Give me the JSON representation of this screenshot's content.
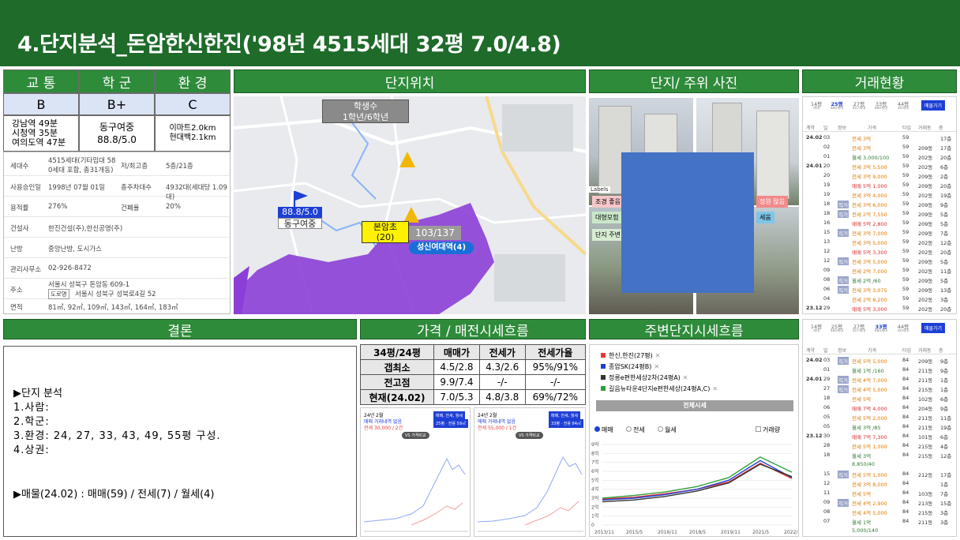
{
  "title": "4.단지분석_돈암한신한진('98년 4515세대 32평 7.0/4.8)",
  "colors": {
    "header_green": "#2e8b3a",
    "title_bar": "#1e6b2a",
    "grade_bg": "#dbe4f5",
    "school_zone": "#8b3fd6"
  },
  "score": {
    "headers": [
      "교 통",
      "학 군",
      "환 경"
    ],
    "grades": [
      "B",
      "B+",
      "C"
    ],
    "transport_lines": [
      "강남역 49분",
      "시청역 35분",
      "여의도역 47분"
    ],
    "school_lines": [
      "동구여중",
      "88.8/5.0"
    ],
    "env_lines": [
      "이마트2.0km",
      "현대백2.1km"
    ]
  },
  "info": [
    {
      "k": "세대수",
      "v": "4515세대(기타임대 58",
      "v2": "0세대 포함, 총31개동)",
      "k2": "저/최고층",
      "v3": "5층/21층"
    },
    {
      "k": "사용승인일",
      "v": "1998년 07월 01일",
      "k2": "총주차대수",
      "v3": "4932대(세대당 1.09대)"
    },
    {
      "k": "용적률",
      "v": "276%",
      "k2": "건폐율",
      "v3": "20%"
    },
    {
      "k": "건설사",
      "v": "한진건설(주),한신공영(주)"
    },
    {
      "k": "난방",
      "v": "중앙난방, 도시가스"
    },
    {
      "k": "관리사무소",
      "v": "02-926-8472"
    },
    {
      "k": "주소",
      "v": "서울시 성북구 돈암동 609-1",
      "tag": "도로명",
      "v2": "서울시 성북구 성북로4길 52"
    },
    {
      "k": "면적",
      "v": "81㎡, 92㎡, 109㎡, 143㎡, 164㎡, 183㎡"
    }
  ],
  "sections": {
    "location": "단지위치",
    "photos": "단지/ 주위 사진",
    "transactions": "거래현황",
    "conclusion": "결론",
    "price_trend": "가격 / 매전시세흐름",
    "nearby_trend": "주변단지시세흐름"
  },
  "map": {
    "students_line1": "학생수",
    "students_line2": "1학년/6학년",
    "school_score": "88.8/5.0",
    "school_name": "동구여중",
    "elem_line1": "본암초",
    "elem_line2": "(20)",
    "ratio": "103/137",
    "station": "성신여대역(4)"
  },
  "photo_overlay": {
    "tags": [
      "Labels",
      "조경 좋음",
      "대형모험",
      "단지 주변",
      "정원 많음",
      "세움"
    ]
  },
  "transactions": {
    "top_tabs": [
      "14평",
      "25평",
      "27평",
      "33평",
      "44평"
    ],
    "top_tab_sub": [
      "세대",
      "480세대",
      "507세대",
      "480세대",
      "46세대"
    ],
    "active_tab_top": "25평",
    "active_tab_bottom": "33평",
    "btn": "매물가기",
    "col_headers": [
      "계약",
      "일",
      "정보",
      "가격",
      "타입",
      "거래동",
      "층"
    ],
    "top_rows": [
      [
        "24.02",
        "03",
        "",
        "전세 3억",
        "59",
        "",
        "17층"
      ],
      [
        "",
        "02",
        "",
        "전세 3억",
        "59",
        "209동",
        "17층"
      ],
      [
        "",
        "01",
        "",
        "월세 3,000/100",
        "59",
        "202동",
        "20층"
      ],
      [
        "24.01",
        "20",
        "",
        "전세 3억 5,500",
        "59",
        "202동",
        "6층"
      ],
      [
        "",
        "20",
        "",
        "전세 3억 9,000",
        "59",
        "209동",
        "2층"
      ],
      [
        "",
        "19",
        "",
        "매매 5억 1,000",
        "59",
        "209동",
        "20층"
      ],
      [
        "",
        "19",
        "",
        "전세 3억 4,000",
        "59",
        "202동",
        "19층"
      ],
      [
        "",
        "18",
        "직거",
        "전세 3억 6,000",
        "59",
        "209동",
        "9층"
      ],
      [
        "",
        "18",
        "직거",
        "전세 2억 7,550",
        "59",
        "209동",
        "5층"
      ],
      [
        "",
        "16",
        "",
        "매매 5억 2,800",
        "59",
        "209동",
        "5층"
      ],
      [
        "",
        "15",
        "직거",
        "전세 3억 7,000",
        "59",
        "209동",
        "7층"
      ],
      [
        "",
        "13",
        "",
        "전세 3억 5,000",
        "59",
        "202동",
        "12층"
      ],
      [
        "",
        "12",
        "",
        "매매 5억 3,300",
        "59",
        "202동",
        "20층"
      ],
      [
        "",
        "12",
        "직거",
        "전세 3억 5,000",
        "59",
        "209동",
        "5층"
      ],
      [
        "",
        "09",
        "",
        "전세 2억 7,000",
        "59",
        "202동",
        "11층"
      ],
      [
        "",
        "08",
        "직거",
        "월세 2억 /60",
        "59",
        "209동",
        "5층"
      ],
      [
        "",
        "06",
        "직거",
        "전세 3억 3,075",
        "59",
        "209동",
        "13층"
      ],
      [
        "",
        "04",
        "",
        "전세 2억 8,200",
        "59",
        "202동",
        "3층"
      ],
      [
        "23.12",
        "29",
        "",
        "매매 5억 3,000",
        "59",
        "202동",
        "20층"
      ]
    ],
    "bottom_rows": [
      [
        "24.02",
        "03",
        "직거",
        "전세 5억 5,000",
        "84",
        "209동",
        "9층"
      ],
      [
        "",
        "01",
        "",
        "월세 1억 /160",
        "84",
        "211동",
        "9층"
      ],
      [
        "24.01",
        "29",
        "직거",
        "전세 4억 7,000",
        "84",
        "211동",
        "1층"
      ],
      [
        "",
        "27",
        "직거",
        "전세 4억 5,000",
        "84",
        "215동",
        "1층"
      ],
      [
        "",
        "18",
        "",
        "전세 5억",
        "84",
        "102동",
        "6층"
      ],
      [
        "",
        "06",
        "",
        "매매 7억 4,000",
        "84",
        "204동",
        "9층"
      ],
      [
        "",
        "05",
        "",
        "전세 5억 2,000",
        "84",
        "211동",
        "11층"
      ],
      [
        "",
        "05",
        "",
        "월세 3억 /85",
        "84",
        "211동",
        "19층"
      ],
      [
        "23.12",
        "30",
        "",
        "매매 7억 7,300",
        "84",
        "101동",
        "6층"
      ],
      [
        "",
        "28",
        "",
        "전세 5억 1,000",
        "84",
        "215동",
        "4층"
      ],
      [
        "",
        "18",
        "",
        "월세 3억",
        "84",
        "215동",
        "12층"
      ],
      [
        "",
        "",
        "",
        "8,850/40",
        "",
        "",
        ""
      ],
      [
        "",
        "15",
        "직거",
        "전세 5억 1,000",
        "84",
        "212동",
        "17층"
      ],
      [
        "",
        "12",
        "",
        "전세 3억 8,000",
        "84",
        "",
        "1층"
      ],
      [
        "",
        "11",
        "",
        "전세 5억",
        "84",
        "103동",
        "7층"
      ],
      [
        "",
        "09",
        "직거",
        "전세 4억 2,900",
        "84",
        "213동",
        "15층"
      ],
      [
        "",
        "08",
        "",
        "전세 4억 5,000",
        "84",
        "215동",
        "3층"
      ],
      [
        "",
        "07",
        "",
        "월세 1억",
        "84",
        "211동",
        "3층"
      ],
      [
        "",
        "",
        "",
        "5,000/140",
        "",
        "",
        ""
      ],
      [
        "",
        "04",
        "",
        "전세 4억 5,000",
        "84",
        "215동",
        "3층"
      ]
    ]
  },
  "conclusion": {
    "heading": "▶단지 분석",
    "lines": [
      "1.사람:",
      "2.학군:",
      "3.환경: 24, 27, 33, 43, 49, 55평 구성.",
      "4.상권:"
    ],
    "listing": "▶매물(24.02) : 매매(59) / 전세(7) / 월세(4)"
  },
  "price_table": {
    "header": [
      "34평/24평",
      "매매가",
      "전세가",
      "전세가율"
    ],
    "rows": [
      [
        "갭최소",
        "4.5/2.8",
        "4.3/2.6",
        "95%/91%"
      ],
      [
        "전고점",
        "9.9/7.4",
        "-/-",
        "-/-"
      ],
      [
        "현재(24.02)",
        "7.0/5.3",
        "4.8/3.8",
        "69%/72%"
      ]
    ]
  },
  "mini_charts": [
    {
      "line1": "24년 2월",
      "line2": "매매 거래내역 없음",
      "line3": "전세 30,000 / 2건",
      "btn": "매매, 전세, 월세",
      "sub": "25평 · 전용 59㎡",
      "vs": "VS 가격비교"
    },
    {
      "line1": "24년 2월",
      "line2": "매매 거래내역 없음",
      "line3": "전세 55,000 / 1건",
      "btn": "매매, 전세, 월세",
      "sub": "33평 · 전용 84㎡",
      "vs": "VS 가격비교"
    }
  ],
  "nearby": {
    "legend": [
      "한신,한진(27평)",
      "종암SK(24평B)",
      "정릉e편한세상2차(24평A)",
      "길음뉴타운4단지e편한세상(24평A,C)"
    ],
    "legend_colors": [
      "#e53935",
      "#1e3fd6",
      "#333333",
      "#2e9e3a"
    ],
    "tab": "전체시세",
    "radios": [
      "매매",
      "전세",
      "월세"
    ],
    "checkbox": "거래량",
    "chart_data": {
      "type": "line",
      "x": [
        "2013/11",
        "2015/5",
        "2016/11",
        "2018/5",
        "2019/11",
        "2021/5",
        "2022/11"
      ],
      "ylabels": [
        "0",
        "1억",
        "2억",
        "3억",
        "4억",
        "5억",
        "6억",
        "7억",
        "8억",
        "9억"
      ],
      "ylim": [
        0,
        9
      ],
      "series": [
        {
          "name": "한신,한진(27평)",
          "color": "#e53935",
          "values": [
            2.9,
            3.1,
            3.5,
            4.0,
            4.8,
            6.9,
            5.2
          ]
        },
        {
          "name": "종암SK(24평B)",
          "color": "#1e3fd6",
          "values": [
            2.8,
            3.0,
            3.4,
            4.0,
            5.0,
            7.2,
            5.3
          ]
        },
        {
          "name": "정릉e편한세상2차(24평A)",
          "color": "#333333",
          "values": [
            2.6,
            2.8,
            3.2,
            3.8,
            4.7,
            6.8,
            5.4
          ]
        },
        {
          "name": "길음뉴타운4단지e편한세상(24평A,C)",
          "color": "#2e9e3a",
          "values": [
            3.0,
            3.3,
            3.7,
            4.3,
            5.3,
            7.6,
            5.9
          ]
        }
      ]
    }
  }
}
